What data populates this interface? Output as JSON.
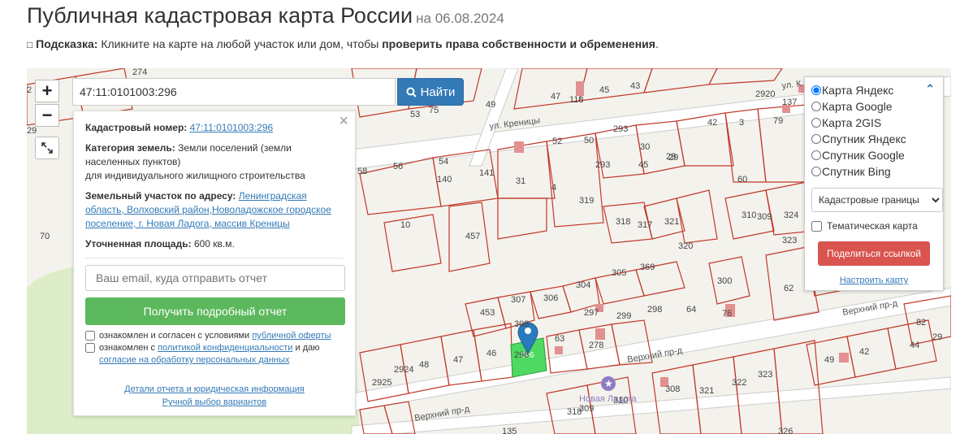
{
  "header": {
    "title": "Публичная кадастровая карта России",
    "date": "на 06.08.2024"
  },
  "hint": {
    "icon": "lightbulb-icon",
    "label": "Подсказка:",
    "text": "Кликните на карте на любой участок или дом, чтобы",
    "bold_text": "проверить права собственности и обременения",
    "end": "."
  },
  "search": {
    "value": "47:11:0101003:296",
    "button_label": "Найти"
  },
  "map": {
    "streets": [
      "ул. Креницы",
      "ул. К",
      "Верхний пр-д",
      "Верхний пр-д",
      "Верхний пр-д",
      "ный пр-д",
      "ный пр-д"
    ],
    "poi_label": "Новая Ладога",
    "parcel_numbers": [
      "274",
      "2",
      "75",
      "53",
      "49",
      "47",
      "118",
      "45",
      "43",
      "2920",
      "137",
      "29",
      "52",
      "50",
      "293",
      "42",
      "3",
      "79",
      "56",
      "54",
      "140",
      "141",
      "31",
      "4",
      "293",
      "30",
      "29",
      "45",
      "29",
      "60",
      "58",
      "10",
      "457",
      "319",
      "318",
      "317",
      "321",
      "310",
      "309",
      "324",
      "70",
      "320",
      "323",
      "305",
      "369",
      "453",
      "307",
      "306",
      "304",
      "300",
      "62",
      "297",
      "299",
      "298",
      "64",
      "76",
      "308",
      "63",
      "278",
      "82",
      "29",
      "48",
      "47",
      "46",
      "296",
      "49",
      "42",
      "44",
      "2925",
      "2924",
      "318",
      "309",
      "310",
      "308",
      "321",
      "322",
      "323",
      "326",
      "135"
    ],
    "accent_color": "#e74c3c",
    "selected_color": "#4dd962"
  },
  "info_panel": {
    "cadastral_label": "Кадастровый номер:",
    "cadastral_value": "47:11:0101003:296",
    "category_label": "Категория земель:",
    "category_value": "Земли поселений (земли населенных пунктов)",
    "category_purpose": "для индивидуального жилищного строительства",
    "address_label": "Земельный участок по адресу:",
    "address_value": "Ленинградская область, Волховский район,Новоладожское городское поселение, г. Новая Ладога, массив Креницы",
    "area_label": "Уточненная площадь:",
    "area_value": "600 кв.м.",
    "email_placeholder": "Ваш email, куда отправить отчет",
    "report_button": "Получить подробный отчет",
    "consent1_text": "ознакомлен и согласен с условиями",
    "consent1_link": "публичной оферты",
    "consent2_text": "ознакомлен с",
    "consent2_link": "политикой конфиденциальности",
    "consent2_and": "и даю",
    "consent2_link2": "согласие на обработку персональных данных",
    "details_link": "Детали отчета и юридическая информация",
    "manual_link": "Ручной выбор вариантов"
  },
  "layers": {
    "options": [
      "Карта Яндекс",
      "Карта Google",
      "Карта 2GIS",
      "Спутник Яндекс",
      "Спутник Google",
      "Спутник Bing"
    ],
    "selected": "Карта Яндекс",
    "overlay_select": "Кадастровые границы",
    "thematic_label": "Тематическая карта",
    "share_button": "Поделиться ссылкой",
    "setup_link": "Настроить карту"
  },
  "controls": {
    "zoom_in": "+",
    "zoom_out": "−"
  }
}
